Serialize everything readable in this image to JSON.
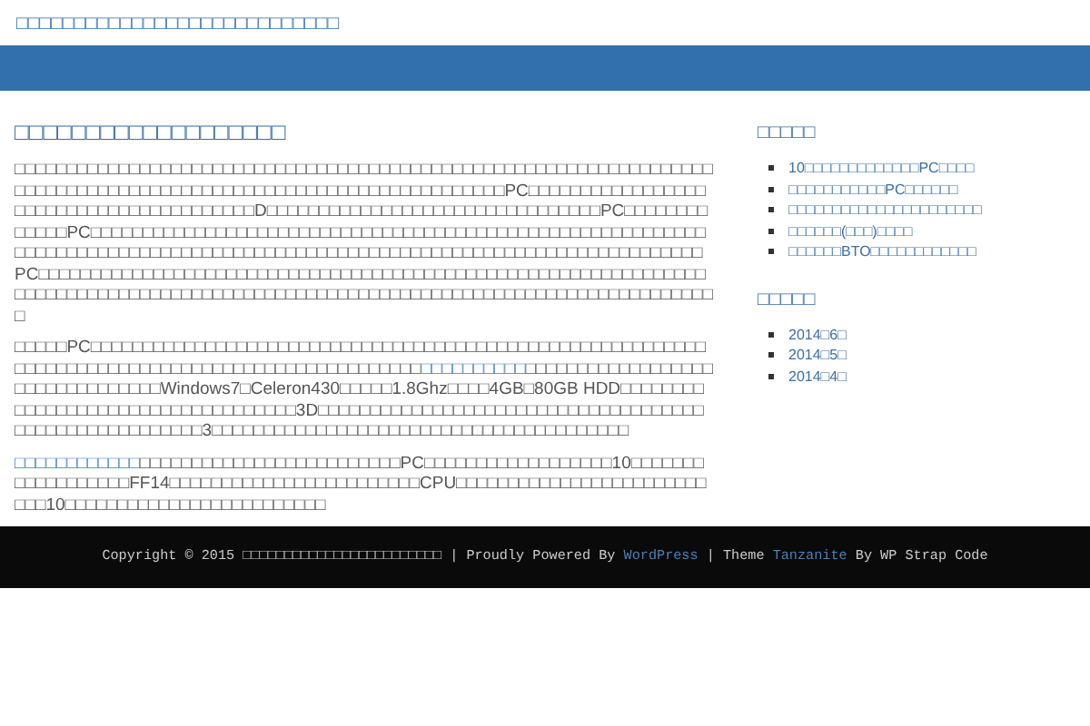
{
  "site_title": "□□□□□□□□□□□□□□□□□□□□□□□□□□□□",
  "article": {
    "title": "□□□□□□□□□□□□□□□□□□□",
    "paragraphs": [
      {
        "segments": [
          {
            "kind": "text",
            "text": "□□□□□□□□□□□□□□□□□□□□□□□□□□□□□□□□□□□□□□□□□□□□□□□□□□□□□□□□□□□□□□□□□□□□□□□□□□□□□□□□□□□□□□□□□□□□□□□□□□□□□□□□□□□□□□□□□□PC□□□□□□□□□□□□□□□□□□□□□□□□□□□□□□□□□□□□□□□□D□□□□□□□□□□□□□□□□□□□□□□□□□□□□□□□□PC□□□□□□□□□□□□□PC□□□□□□□□□□□□□□□□□□□□□□□□□□□□□□□□□□□□□□□□□□□□□□□□□□□□□□□□□□□□□□□□□□□□□□□□□□□□□□□□□□□□□□□□□□□□□□□□□□□□□□□□□□□□□□□□□□□□□□□□□□□□□PC□□□□□□□□□□□□□□□□□□□□□□□□□□□□□□□□□□□□□□□□□□□□□□□□□□□□□□□□□□□□□□□□□□□□□□□□□□□□□□□□□□□□□□□□□□□□□□□□□□□□□□□□□□□□□□□□□□□□□□□□□□□□□□□□□□□□"
          }
        ]
      },
      {
        "segments": [
          {
            "kind": "text",
            "text": "□□□□□PC□□□□□□□□□□□□□□□□□□□□□□□□□□□□□□□□□□□□□□□□□□□□□□□□□□□□□□□□□□□□□□□□□□□□□□□□□□□□□□□□□□□□□□□□□□□□□□□□□□"
          },
          {
            "kind": "link",
            "text": "□□□□□□□□□□"
          },
          {
            "kind": "text",
            "text": "□□□□□□□□□□□□□□□□□□□□□□□□□□□□□□□□Windows7□Celeron430□□□□□1.8Ghz□□□□4GB□80GB HDD□□□□□□□□□□□□□□□□□□□□□□□□□□□□□□□□□□□3D□□□□□□□□□□□□□□□□□□□□□□□□□□□□□□□□□□□□□□□□□□□□□□□□□□□□□□□3□□□□□□□□□□□□□□□□□□□□□□□□□□□□□□□□□□□□□□□□"
          }
        ]
      },
      {
        "segments": [
          {
            "kind": "link",
            "text": "□□□□□□□□□□□□"
          },
          {
            "kind": "text",
            "text": "□□□□□□□□□□□□□□□□□□□□□□□□□PC□□□□□□□□□□□□□□□□□□10□□□□□□□□□□□□□□□□□□FF14□□□□□□□□□□□□□□□□□□□□□□□□CPU□□□□□□□□□□□□□□□□□□□□□□□□□□□10□□□□□□□□□□□□□□□□□□□□□□□□□"
          }
        ]
      }
    ]
  },
  "sidebar": [
    {
      "title": "□□□□□",
      "items": [
        "10□□□□□□□□□□□□□PC□□□□",
        "□□□□□□□□□□□PC□□□□□□",
        "□□□□□□□□□□□□□□□□□□□□□□",
        "□□□□□□(□□□)□□□□",
        "□□□□□□BTO□□□□□□□□□□□□"
      ]
    },
    {
      "title": "□□□□□",
      "items": [
        "2014□6□",
        "2014□5□",
        "2014□4□"
      ]
    }
  ],
  "footer": {
    "segments": [
      {
        "kind": "text",
        "text": "Copyright © 2015 □□□□□□□□□□□□□□□□□□□□□□□□ | Proudly Powered By "
      },
      {
        "kind": "link",
        "text": "WordPress"
      },
      {
        "kind": "text",
        "text": " | Theme "
      },
      {
        "kind": "link",
        "text": "Tanzanite"
      },
      {
        "kind": "text",
        "text": " By WP Strap Code"
      }
    ]
  }
}
